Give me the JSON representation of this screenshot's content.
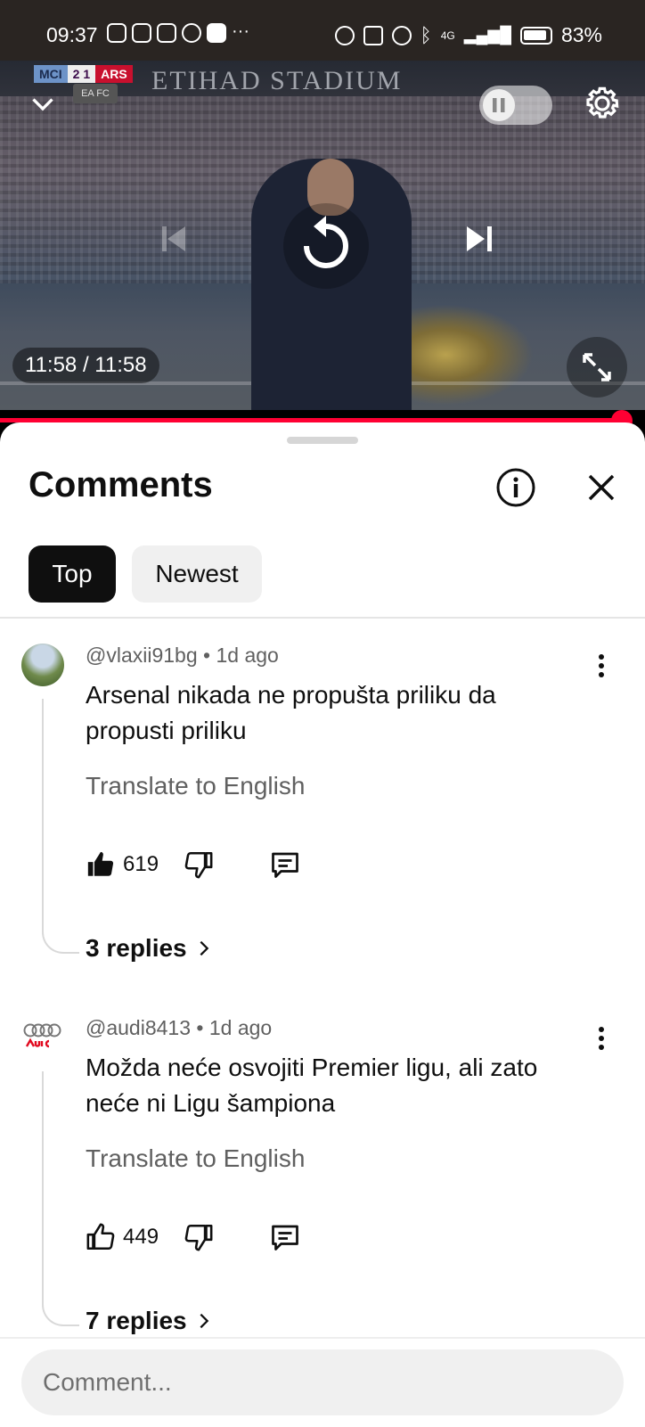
{
  "status_bar": {
    "time": "09:37",
    "network": "4G",
    "battery": "83%",
    "app_icons": [
      "instagram-icon",
      "chat-icon",
      "instagram-icon",
      "messenger-icon",
      "youtube-icon"
    ],
    "system_icons": [
      "eye-icon",
      "nfc-icon",
      "alarm-icon",
      "bluetooth-icon",
      "signal-icon",
      "battery-icon"
    ]
  },
  "video": {
    "scoreboard": {
      "home": "MCI",
      "score": "2 1",
      "away": "ARS"
    },
    "stadium_text": "ETIHAD STADIUM",
    "ea_badge": "EA FC",
    "time_display": "11:58 / 11:58",
    "progress": 1.0,
    "autoplay_on": false
  },
  "comments_panel": {
    "title": "Comments",
    "filters": [
      {
        "label": "Top",
        "selected": true
      },
      {
        "label": "Newest",
        "selected": false
      }
    ],
    "comments": [
      {
        "author": "@vlaxii91bg",
        "age": "1d ago",
        "text": "Arsenal nikada ne propušta priliku da propusti priliku",
        "translate": "Translate to English",
        "likes": "619",
        "replies": "3 replies"
      },
      {
        "author": "@audi8413",
        "age": "1d ago",
        "text": "Možda neće osvojiti Premier ligu, ali zato neće ni Ligu šampiona",
        "translate": "Translate to English",
        "likes": "449",
        "replies": "7 replies"
      }
    ],
    "composer_placeholder": "Comment..."
  },
  "colors": {
    "accent": "#ff0033",
    "text_primary": "#0f0f0f",
    "text_secondary": "#606060",
    "chip_selected_bg": "#0f0f0f",
    "chip_bg": "#f0f0f0"
  }
}
